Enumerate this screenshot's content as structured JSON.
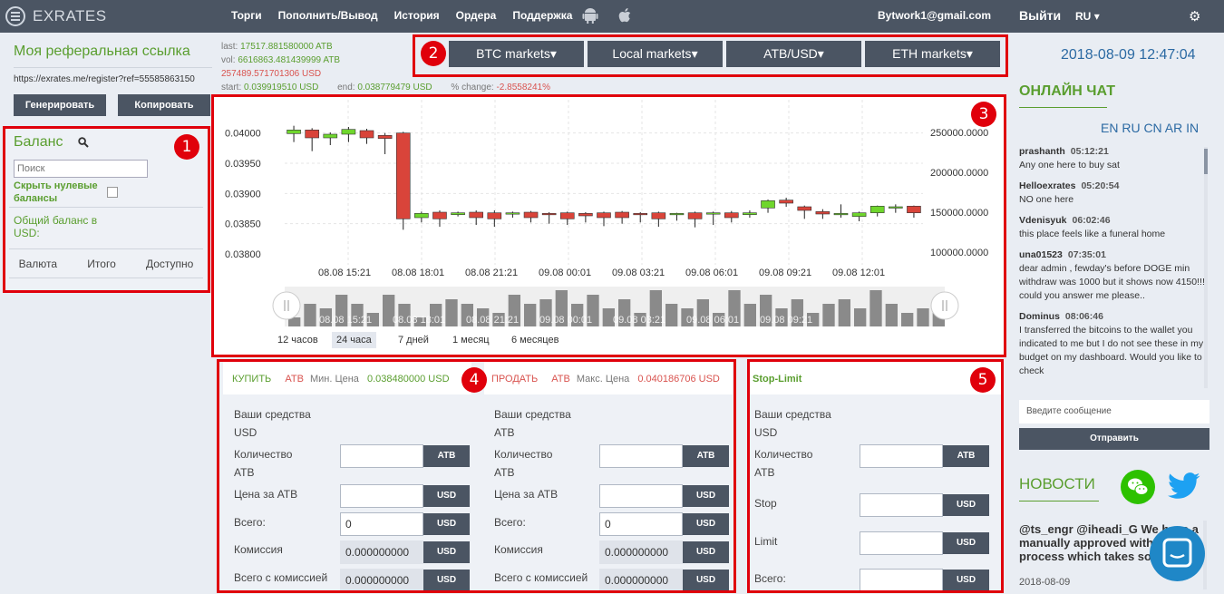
{
  "header": {
    "logo_text": "EXRATES",
    "nav": [
      "Торги",
      "Пополнить/Вывод",
      "История",
      "Ордера",
      "Поддержка"
    ],
    "email": "Bytwork1@gmail.com",
    "logout": "Выйти",
    "lang": "RU"
  },
  "referral": {
    "title": "Моя реферальная ссылка",
    "link": "https://exrates.me/register?ref=55585863150",
    "generate": "Генерировать",
    "copy": "Копировать"
  },
  "balance": {
    "title": "Баланс",
    "search_placeholder": "Поиск",
    "hide_zero": "Скрыть нулевые балансы",
    "total": "Общий баланс в USD:",
    "col_currency": "Валюта",
    "col_total": "Итого",
    "col_available": "Доступно"
  },
  "stats": {
    "last_label": "last:",
    "last": "17517.881580000 ATB",
    "vol_label": "vol:",
    "vol": "6616863.481439999 ATB",
    "usd": "257489.571701306 USD",
    "start_label": "start:",
    "start": "0.039919510 USD",
    "end_label": "end:",
    "end": "0.038779479 USD",
    "change_label": "% change:",
    "change": "-2.8558241%"
  },
  "markets": [
    "BTC markets",
    "Local markets",
    "ATB/USD",
    "ETH markets"
  ],
  "timeframes": [
    "12 часов",
    "24 часа",
    "7 дней",
    "1 месяц",
    "6 месяцев"
  ],
  "chart_data": {
    "type": "candlestick",
    "price_axis": [
      "0.04000",
      "0.03950",
      "0.03900",
      "0.03850",
      "0.03800"
    ],
    "volume_axis": [
      "250000.0000",
      "200000.0000",
      "150000.0000",
      "100000.0000"
    ],
    "x_labels": [
      "08.08 15:21",
      "08.08 18:01",
      "08.08 21:21",
      "09.08 00:01",
      "09.08 03:21",
      "09.08 06:01",
      "09.08 09:21",
      "09.08 12:01"
    ],
    "navigator_labels": [
      "08.08 15:21",
      "08.08 18:01",
      "08.08 21:21",
      "09.08 00:01",
      "09.08 03:21",
      "09.08 06:01",
      "09.08 09:21"
    ],
    "ylim": [
      0.038,
      0.0401
    ],
    "candles": [
      [
        0.03999,
        0.04005,
        0.04012,
        0.03985
      ],
      [
        0.04005,
        0.03992,
        0.04008,
        0.0397
      ],
      [
        0.03992,
        0.03998,
        0.04001,
        0.0398
      ],
      [
        0.03998,
        0.04006,
        0.0401,
        0.03985
      ],
      [
        0.04004,
        0.03992,
        0.04007,
        0.03982
      ],
      [
        0.03996,
        0.03991,
        0.04,
        0.03965
      ],
      [
        0.04,
        0.03858,
        0.04002,
        0.0384
      ],
      [
        0.0386,
        0.03867,
        0.0387,
        0.03852
      ],
      [
        0.03869,
        0.03858,
        0.03872,
        0.03845
      ],
      [
        0.03865,
        0.03868,
        0.0387,
        0.03862
      ],
      [
        0.03869,
        0.0386,
        0.03872,
        0.03848
      ],
      [
        0.03868,
        0.03858,
        0.03872,
        0.03845
      ],
      [
        0.03866,
        0.03868,
        0.0387,
        0.0386
      ],
      [
        0.03869,
        0.0386,
        0.03871,
        0.03852
      ],
      [
        0.03867,
        0.03866,
        0.03869,
        0.0385
      ],
      [
        0.03868,
        0.03858,
        0.0387,
        0.03848
      ],
      [
        0.03867,
        0.03863,
        0.03869,
        0.03852
      ],
      [
        0.03868,
        0.0386,
        0.0387,
        0.03846
      ],
      [
        0.03869,
        0.0386,
        0.03871,
        0.0385
      ],
      [
        0.03867,
        0.03866,
        0.03869,
        0.03852
      ],
      [
        0.03868,
        0.03858,
        0.0387,
        0.03845
      ],
      [
        0.03866,
        0.03867,
        0.03868,
        0.03855
      ],
      [
        0.03868,
        0.03858,
        0.0387,
        0.03844
      ],
      [
        0.03866,
        0.03868,
        0.0387,
        0.03848
      ],
      [
        0.03868,
        0.0386,
        0.03871,
        0.03852
      ],
      [
        0.03865,
        0.03868,
        0.03872,
        0.0386
      ],
      [
        0.03876,
        0.03888,
        0.0389,
        0.03868
      ],
      [
        0.03889,
        0.03884,
        0.03893,
        0.03878
      ],
      [
        0.03878,
        0.03872,
        0.0388,
        0.03858
      ],
      [
        0.0387,
        0.03866,
        0.03874,
        0.03858
      ],
      [
        0.03866,
        0.03867,
        0.03882,
        0.0386
      ],
      [
        0.03862,
        0.03868,
        0.0387,
        0.03854
      ],
      [
        0.03868,
        0.03879,
        0.0388,
        0.03862
      ],
      [
        0.03878,
        0.03878,
        0.03882,
        0.03868
      ],
      [
        0.03879,
        0.03868,
        0.0388,
        0.0386
      ]
    ],
    "volumes": [
      2,
      5,
      4,
      7,
      5,
      3,
      7,
      5,
      2,
      5,
      6,
      5,
      4,
      3,
      7,
      5,
      6,
      8,
      5,
      7,
      4,
      6,
      3,
      8,
      5,
      4,
      6,
      3,
      8,
      5,
      7,
      4,
      6,
      3,
      5,
      6,
      4,
      8,
      5,
      3,
      4,
      6
    ]
  },
  "buy": {
    "title": "КУПИТЬ",
    "asset": "ATB",
    "min_label": "Мин. Цена",
    "min_value": "0.038480000 USD",
    "funds": "Ваши средства",
    "funds_unit": "USD",
    "qty_label": "Количество",
    "qty_unit_label": "ATB",
    "qty_unit": "ATB",
    "price_label": "Цена за ATB",
    "price_unit": "USD",
    "total_label": "Всего:",
    "total_value": "0",
    "total_unit": "USD",
    "fee_label": "Комиссия",
    "fee_value": "0.000000000",
    "fee_unit": "USD",
    "total_fee_label": "Всего с комиссией",
    "total_fee_value": "0.000000000",
    "total_fee_unit": "USD"
  },
  "sell": {
    "title": "ПРОДАТЬ",
    "asset": "ATB",
    "max_label": "Макс. Цена",
    "max_value": "0.040186706 USD",
    "funds": "Ваши средства",
    "funds_unit": "ATB",
    "qty_label": "Количество",
    "qty_unit_label": "ATB",
    "qty_unit": "ATB",
    "price_label": "Цена за ATB",
    "price_unit": "USD",
    "total_label": "Всего:",
    "total_value": "0",
    "total_unit": "USD",
    "fee_label": "Комиссия",
    "fee_value": "0.000000000",
    "fee_unit": "USD",
    "total_fee_label": "Всего с комиссией",
    "total_fee_value": "0.000000000",
    "total_fee_unit": "USD"
  },
  "stoplimit": {
    "title": "Stop-Limit",
    "funds": "Ваши средства",
    "funds_unit": "USD",
    "qty_label": "Количество",
    "qty_unit_label": "ATB",
    "qty_unit": "ATB",
    "stop_label": "Stop",
    "stop_unit": "USD",
    "limit_label": "Limit",
    "limit_unit": "USD",
    "total_label": "Всего:",
    "total_unit": "USD"
  },
  "right": {
    "datetime": "2018-08-09 12:47:04",
    "chat_title": "ОНЛАЙН ЧАТ",
    "chat_langs": "EN RU CN AR IN",
    "messages": [
      {
        "user": "prashanth",
        "time": "05:12:21",
        "text": "Any one here to buy sat"
      },
      {
        "user": "Helloexrates",
        "time": "05:20:54",
        "text": "NO one here"
      },
      {
        "user": "Vdenisyuk",
        "time": "06:02:46",
        "text": "this place feels like a funeral home"
      },
      {
        "user": "una01523",
        "time": "07:35:01",
        "text": "dear admin , fewday's before DOGE min withdraw was 1000 but it shows now 4150!!! could you answer me please.."
      },
      {
        "user": "Dominus",
        "time": "08:06:46",
        "text": "I transferred the bitcoins to the wallet you indicated to me but I do not see these in my budget on my dashboard. Would you like to check"
      }
    ],
    "message_placeholder": "Введите сообщение",
    "send": "Отправить",
    "news_title": "НОВОСТИ",
    "news_text": "@ts_engr @iheadi_G We have a manually approved withdrawal process which takes some time",
    "news_date": "2018-08-09"
  },
  "annotations": [
    "1",
    "2",
    "3",
    "4",
    "5"
  ],
  "colors": {
    "green": "#5a9e2f",
    "red": "#d9534f",
    "dark": "#4b5563",
    "blue": "#2c6aa3",
    "annotation": "#e0000b"
  }
}
